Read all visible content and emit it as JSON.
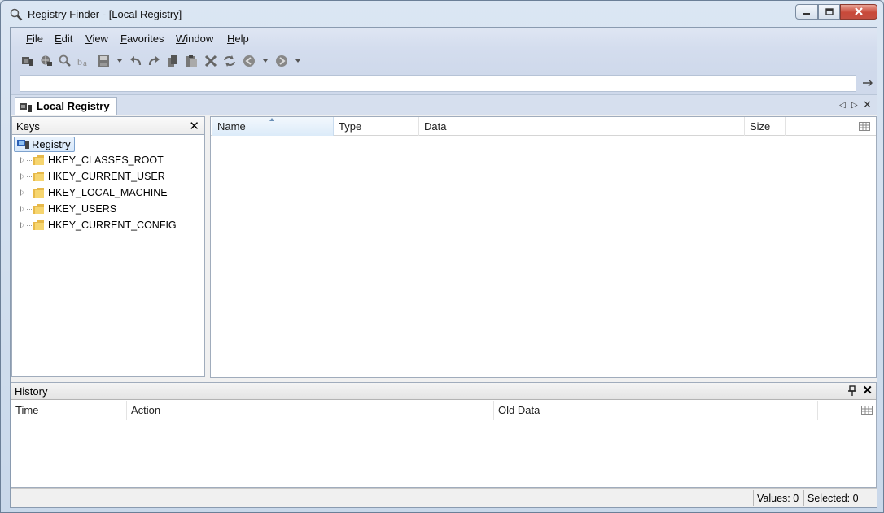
{
  "window": {
    "title": "Registry Finder - [Local Registry]"
  },
  "menu": [
    {
      "label": "File"
    },
    {
      "label": "Edit"
    },
    {
      "label": "View"
    },
    {
      "label": "Favorites"
    },
    {
      "label": "Window"
    },
    {
      "label": "Help"
    }
  ],
  "address": {
    "value": "",
    "placeholder": ""
  },
  "doc_tab": {
    "label": "Local Registry"
  },
  "keys_pane": {
    "title": "Keys",
    "root": "Registry",
    "items": [
      {
        "label": "HKEY_CLASSES_ROOT"
      },
      {
        "label": "HKEY_CURRENT_USER"
      },
      {
        "label": "HKEY_LOCAL_MACHINE"
      },
      {
        "label": "HKEY_USERS"
      },
      {
        "label": "HKEY_CURRENT_CONFIG"
      }
    ]
  },
  "values_pane": {
    "columns": [
      {
        "label": "Name"
      },
      {
        "label": "Type"
      },
      {
        "label": "Data"
      },
      {
        "label": "Size"
      }
    ]
  },
  "history": {
    "title": "History",
    "columns": [
      {
        "label": "Time"
      },
      {
        "label": "Action"
      },
      {
        "label": "Old Data"
      }
    ]
  },
  "status": {
    "values": "Values: 0",
    "selected": "Selected: 0"
  },
  "colors": {
    "accent": "#7da2ce",
    "toolbar": "#cfd9eb",
    "close": "#c8493a"
  }
}
